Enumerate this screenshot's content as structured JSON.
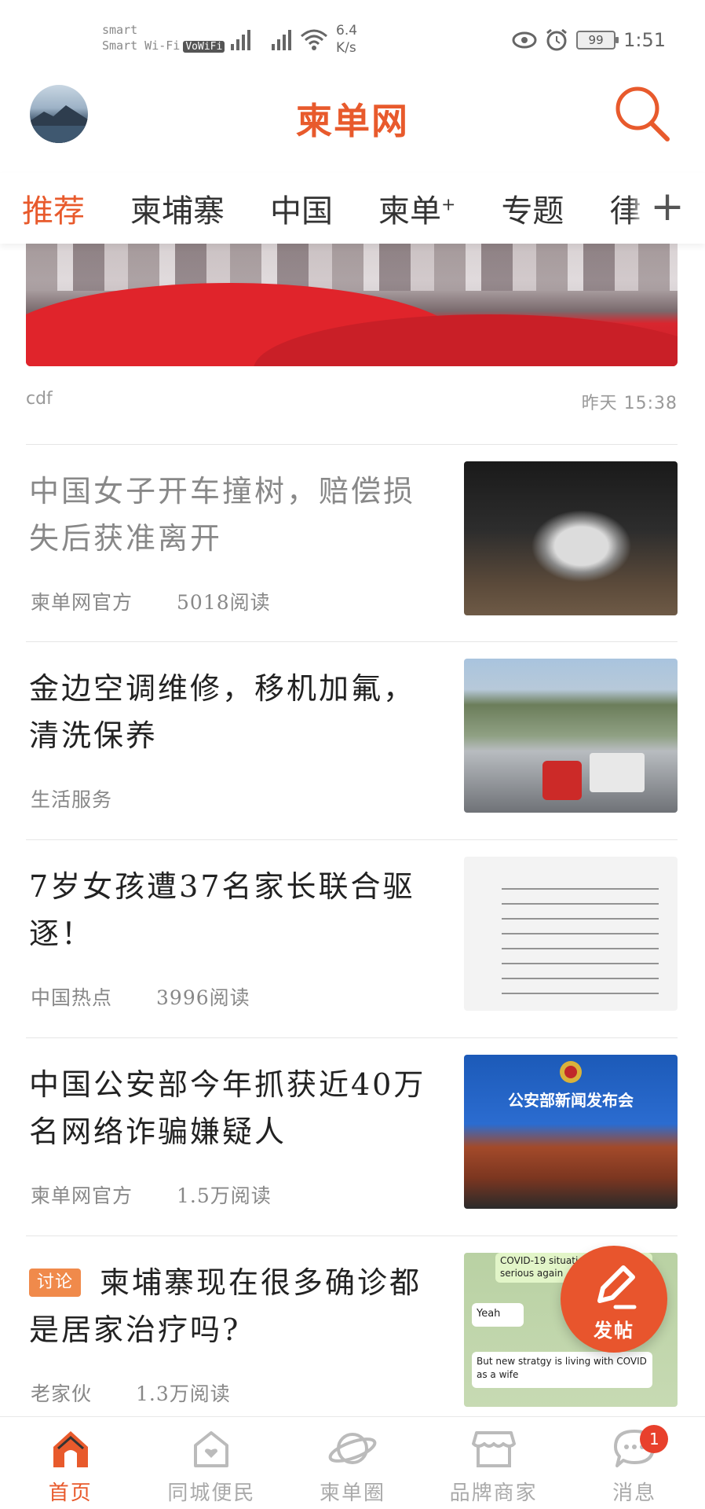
{
  "status_bar": {
    "carrier_line1": "smart",
    "carrier_line2": "Smart Wi-Fi",
    "vowifi": "VoWiFi",
    "speed_value": "6.4",
    "speed_unit": "K/s",
    "battery": "99",
    "time": "1:51"
  },
  "header": {
    "title": "柬单网"
  },
  "tabs": {
    "items": [
      "推荐",
      "柬埔寨",
      "中国",
      "柬单",
      "专题",
      "律"
    ],
    "plus_suffix": "+",
    "active_index": 0
  },
  "banner": {
    "source": "cdf",
    "time": "昨天 15:38"
  },
  "feed": [
    {
      "title": "中国女子开车撞树，赔偿损失后获准离开",
      "source": "柬单网官方",
      "reads": "5018阅读",
      "read_state": "read"
    },
    {
      "title": "金边空调维修，移机加氟，清洗保养",
      "source": "生活服务",
      "reads": ""
    },
    {
      "title": "7岁女孩遭37名家长联合驱逐！",
      "source": "中国热点",
      "reads": "3996阅读"
    },
    {
      "title": "中国公安部今年抓获近40万名网络诈骗嫌疑人",
      "source": "柬单网官方",
      "reads": "1.5万阅读"
    },
    {
      "title": "柬埔寨现在很多确诊都是居家治疗吗?",
      "tag": "讨论",
      "source": "老家伙",
      "reads": "1.3万阅读"
    }
  ],
  "thumbs": {
    "police_banner": "公安部新闻发布会",
    "covid_line1": "COVID-19 situati...",
    "covid_line2": "serious again",
    "covid_yeah": "Yeah",
    "covid_line3": "But new stratgy is living with COVID as a wife"
  },
  "fab": {
    "label": "发帖"
  },
  "bottom_nav": {
    "items": [
      {
        "label": "首页",
        "icon": "home-icon"
      },
      {
        "label": "同城便民",
        "icon": "city-house-icon"
      },
      {
        "label": "柬单圈",
        "icon": "planet-icon"
      },
      {
        "label": "品牌商家",
        "icon": "shop-icon"
      },
      {
        "label": "消息",
        "icon": "message-icon"
      }
    ],
    "active_index": 0,
    "message_badge": "1"
  },
  "colors": {
    "accent": "#e85a2c",
    "tag": "#f08a4b",
    "badge": "#e8402c"
  }
}
